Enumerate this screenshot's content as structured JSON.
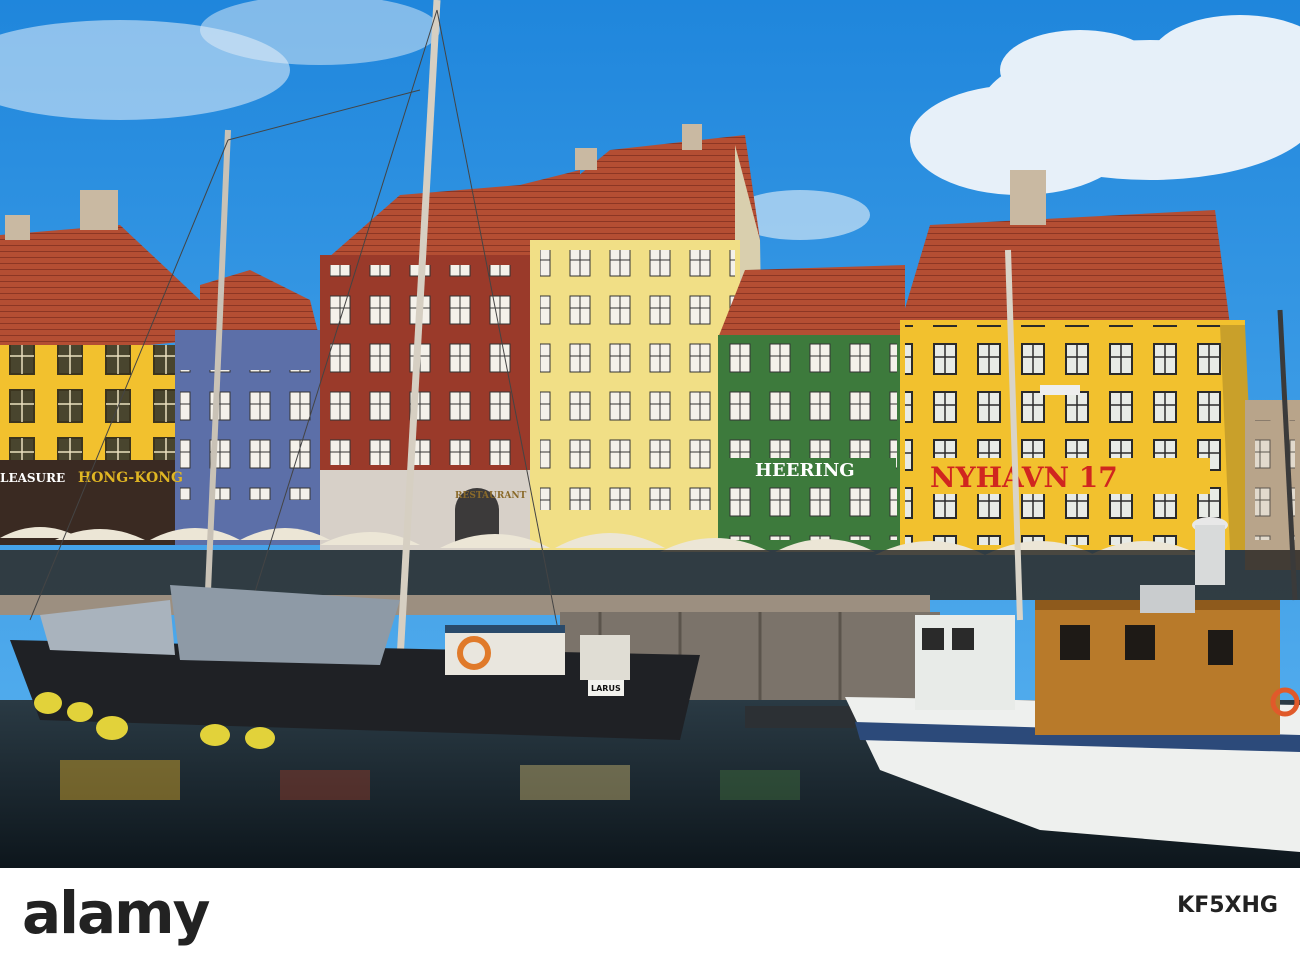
{
  "photo": {
    "signs": {
      "nyhavn": "NYHAVN 17",
      "heering": "HEERING",
      "hong_kong": "HONG-KONG",
      "pleasure": "LEASURE",
      "restaurant": "RESTAURANT",
      "boat_name": "LARUS"
    }
  },
  "footer": {
    "logo": "alamy",
    "image_id": "KF5XHG"
  },
  "colors": {
    "sky": "#2a8fe0",
    "water": "#16232c",
    "yellow_building": "#f2c12e",
    "green_building": "#3d7a3c",
    "red_building": "#9a3a2a",
    "roof": "#b44e33"
  }
}
